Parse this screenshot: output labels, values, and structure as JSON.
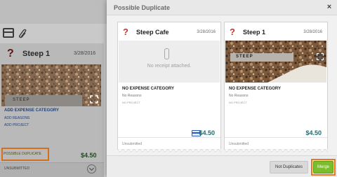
{
  "modal": {
    "title": "Possible Duplicate",
    "close_glyph": "×",
    "expenses": [
      {
        "title": "Steep Cafe",
        "date": "3/28/2016",
        "receipt_message": "No receipt attached.",
        "category": "NO EXPENSE CATEGORY",
        "reasons": "No Reasons",
        "project": "NO PROJECT",
        "amount": "$4.50",
        "status": "Unsubmitted",
        "payment_icon": "credit-card-icon"
      },
      {
        "title": "Steep 1",
        "date": "3/28/2016",
        "receipt_label": "STEEP",
        "category": "NO EXPENSE CATEGORY",
        "reasons": "No Reasons",
        "project": "NO PROJECT",
        "amount": "$4.50",
        "status": "Unsubmitted"
      }
    ],
    "buttons": {
      "no_duplicates": "Not Duplicates",
      "merge": "Merge"
    }
  },
  "background": {
    "expense": {
      "title": "Steep 1",
      "date": "3/28/2016",
      "receipt_label": "STEEP",
      "add_category": "ADD EXPENSE CATEGORY",
      "add_reasons": "ADD REASONS",
      "add_project": "ADD PROJECT",
      "flag": "POSSIBLE DUPLICATE",
      "amount": "$4.50",
      "status": "UNSUBMITTED"
    }
  },
  "colors": {
    "merge": "#7bbd2a",
    "highlight": "#e8791f",
    "amount": "#1d6f6f",
    "question_mark": "#c0392b"
  }
}
